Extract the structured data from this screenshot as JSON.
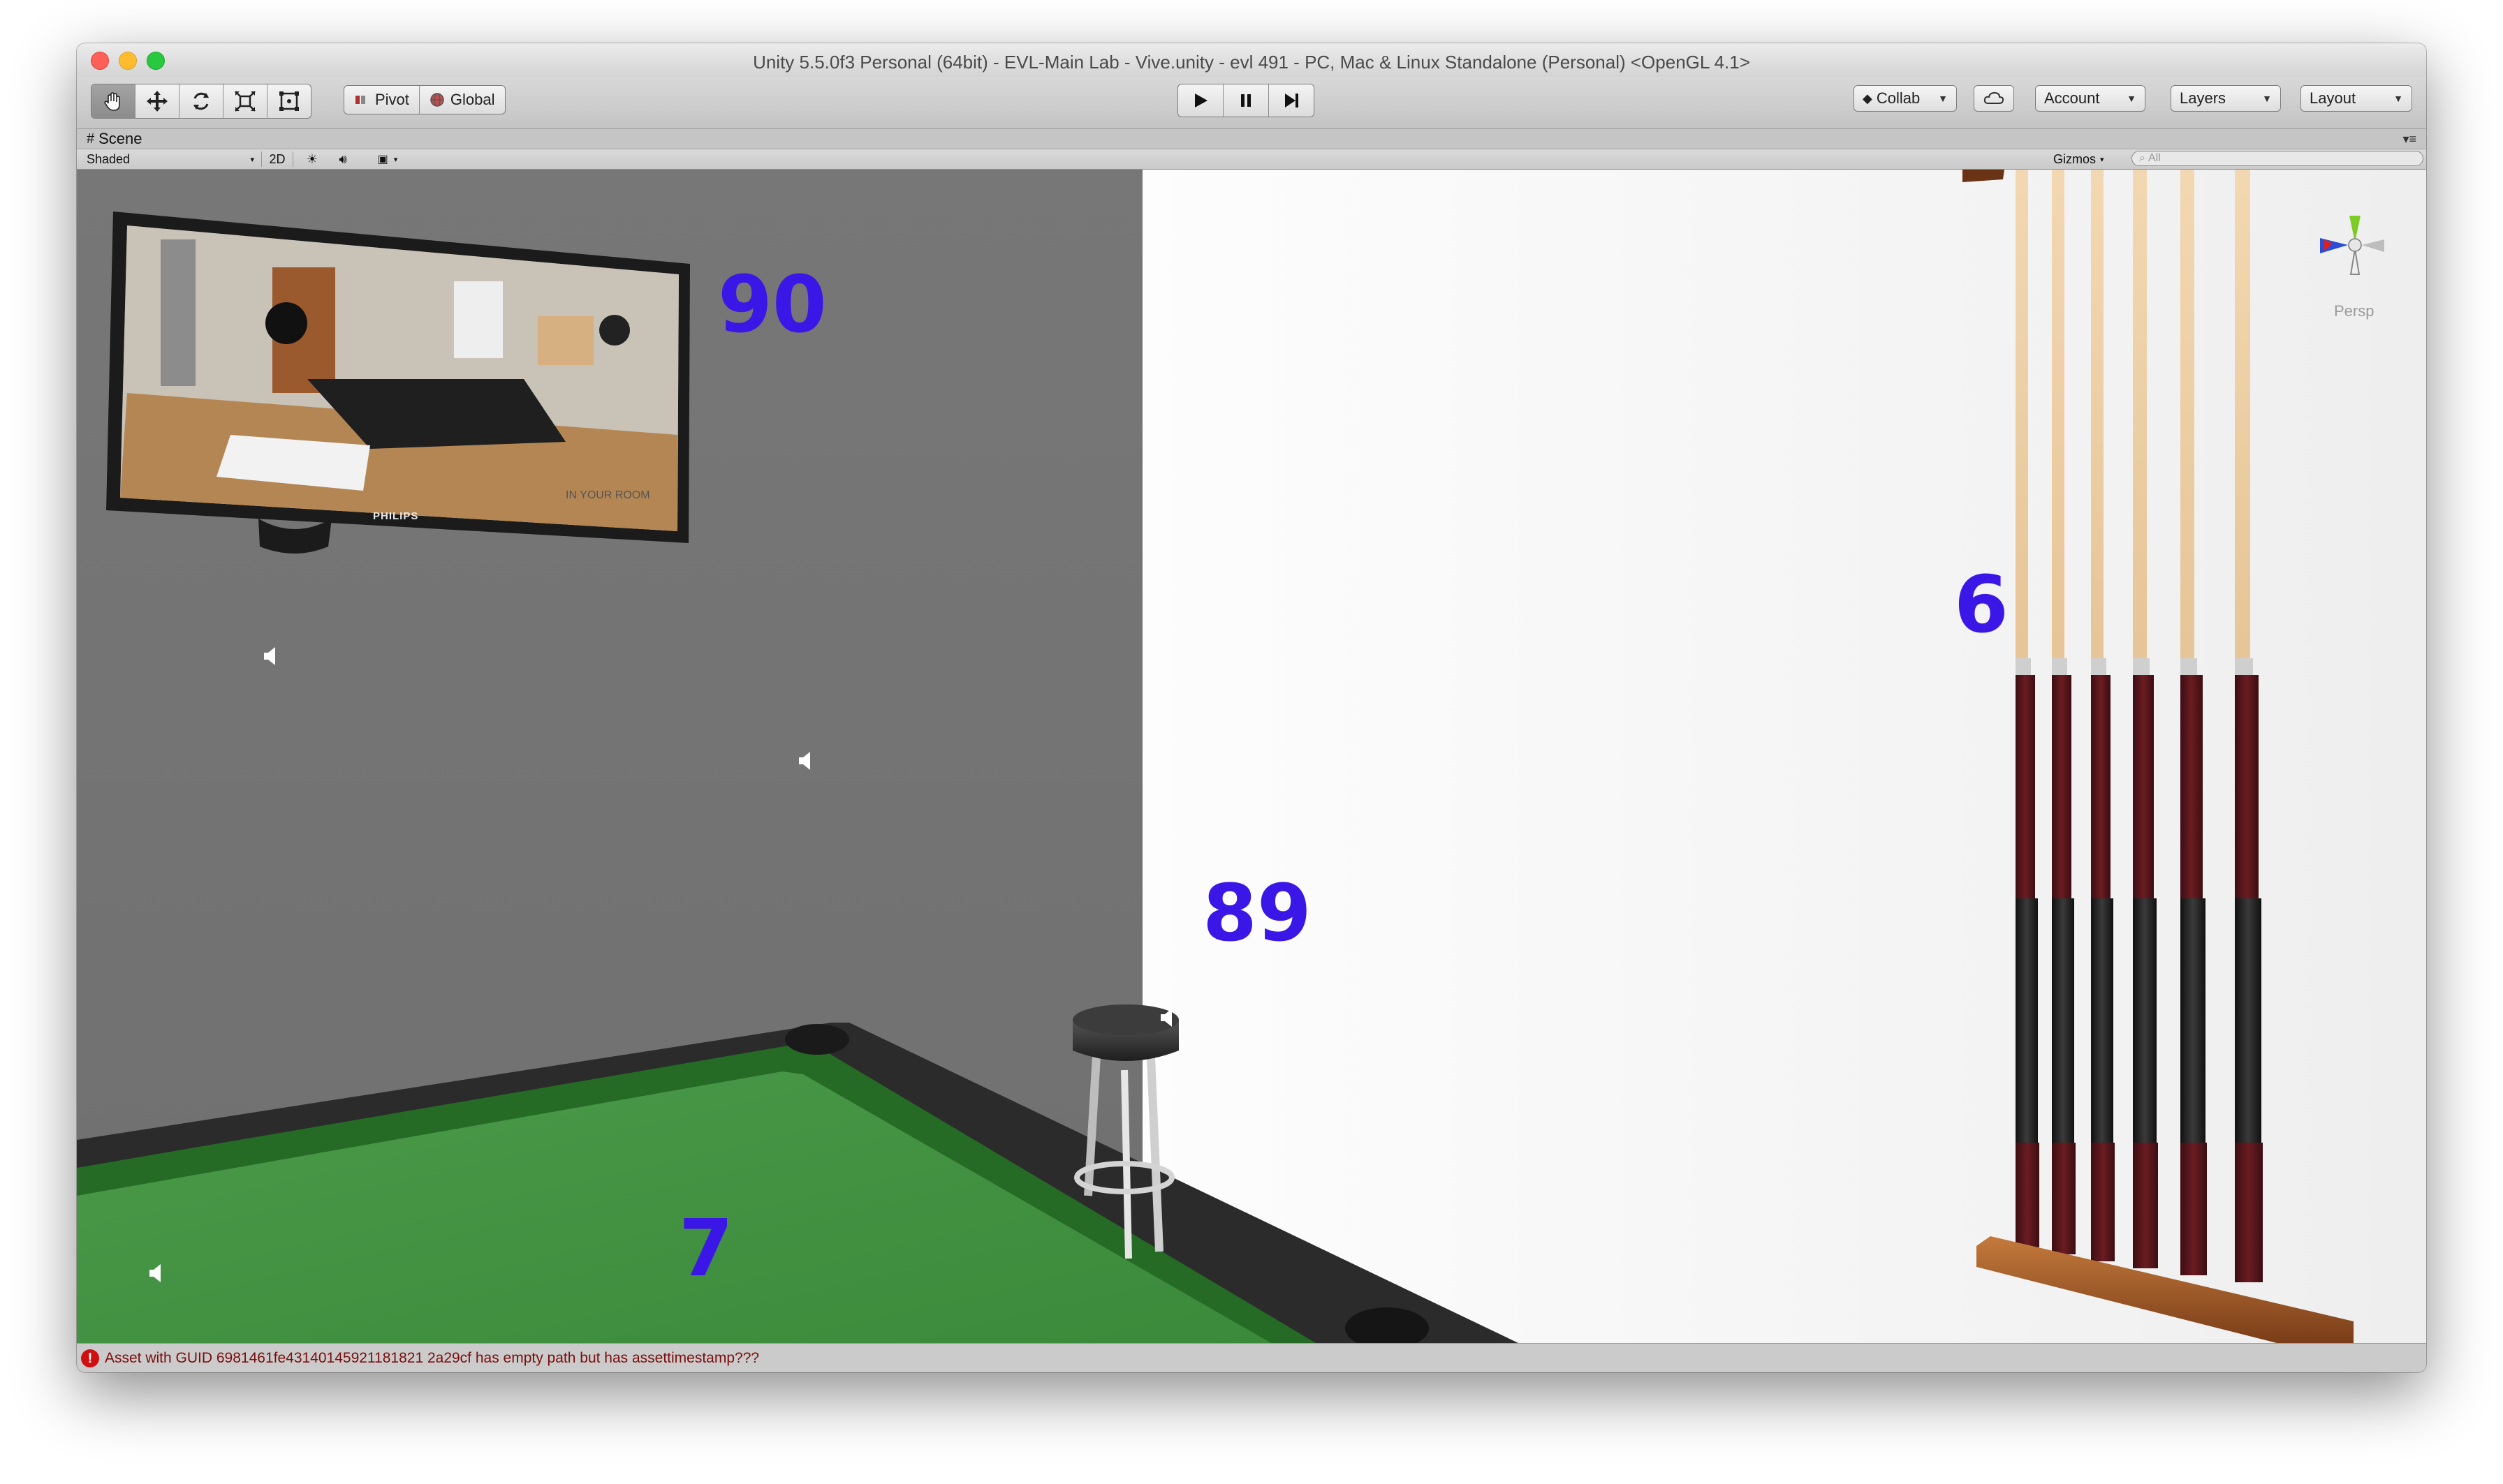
{
  "window": {
    "title": "Unity 5.5.0f3 Personal (64bit) - EVL-Main Lab - Vive.unity - evl 491 - PC, Mac & Linux Standalone (Personal) <OpenGL 4.1>"
  },
  "toolbar": {
    "tools": [
      "hand-tool",
      "move-tool",
      "rotate-tool",
      "scale-tool",
      "rect-tool"
    ],
    "pivot_label": "Pivot",
    "global_label": "Global",
    "collab_label": "Collab",
    "account_label": "Account",
    "layers_label": "Layers",
    "layout_label": "Layout"
  },
  "scene": {
    "tab_label": "Scene",
    "shading_mode": "Shaded",
    "mode_2d_label": "2D",
    "gizmos_label": "Gizmos",
    "search_placeholder": "All",
    "persp_label": "Persp",
    "tv_brand": "PHILIPS",
    "tv_caption": "IN YOUR ROOM",
    "annotations": [
      "90",
      "89",
      "6",
      "7"
    ]
  },
  "status": {
    "error_message": "Asset with GUID 6981461fe43140145921181821 2a29cf has empty path but has assettimestamp???"
  },
  "colors": {
    "annotation": "#3a17e6",
    "felt": "#3f8d3f",
    "error": "#d01010"
  }
}
